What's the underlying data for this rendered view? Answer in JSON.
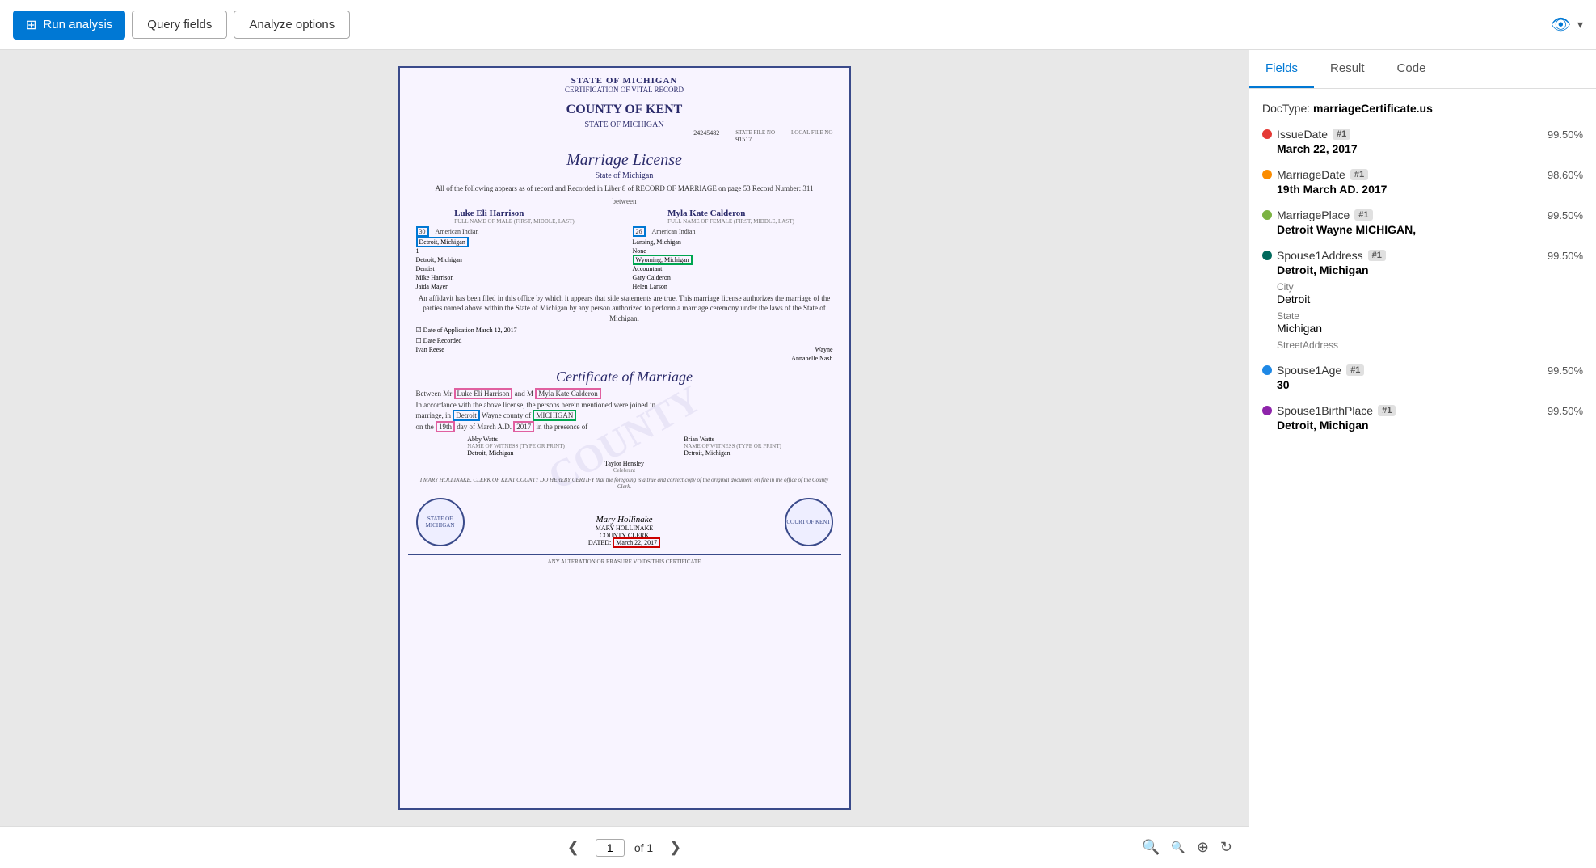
{
  "toolbar": {
    "run_label": "Run analysis",
    "query_fields_label": "Query fields",
    "analyze_options_label": "Analyze options"
  },
  "panel": {
    "tabs": [
      {
        "id": "fields",
        "label": "Fields",
        "active": true
      },
      {
        "id": "result",
        "label": "Result",
        "active": false
      },
      {
        "id": "code",
        "label": "Code",
        "active": false
      }
    ],
    "doctype_label": "DocType:",
    "doctype_value": "marriageCertificate.us",
    "fields": [
      {
        "name": "IssueDate",
        "badge": "#1",
        "confidence": "99.50%",
        "value": "March 22, 2017",
        "dot_color": "#e53935",
        "subitems": []
      },
      {
        "name": "MarriageDate",
        "badge": "#1",
        "confidence": "98.60%",
        "value": "19th March AD. 2017",
        "dot_color": "#fb8c00",
        "subitems": []
      },
      {
        "name": "MarriagePlace",
        "badge": "#1",
        "confidence": "99.50%",
        "value": "Detroit Wayne MICHIGAN,",
        "dot_color": "#7cb342",
        "subitems": []
      },
      {
        "name": "Spouse1Address",
        "badge": "#1",
        "confidence": "99.50%",
        "value": "Detroit, Michigan",
        "dot_color": "#00695c",
        "subitems": [
          {
            "label": "City",
            "value": "Detroit"
          },
          {
            "label": "State",
            "value": "Michigan"
          },
          {
            "label": "StreetAddress",
            "value": ""
          }
        ]
      },
      {
        "name": "Spouse1Age",
        "badge": "#1",
        "confidence": "99.50%",
        "value": "30",
        "dot_color": "#1e88e5",
        "subitems": []
      },
      {
        "name": "Spouse1BirthPlace",
        "badge": "#1",
        "confidence": "99.50%",
        "value": "Detroit, Michigan",
        "dot_color": "#8e24aa",
        "subitems": []
      }
    ]
  },
  "pagination": {
    "current_page": "1",
    "of_label": "of 1",
    "prev_label": "❮",
    "next_label": "❯"
  },
  "certificate": {
    "state_title": "STATE OF MICHIGAN",
    "certification": "CERTIFICATION OF VITAL RECORD",
    "county": "COUNTY OF KENT",
    "state_name": "STATE OF MICHIGAN",
    "file_no_1": "24245482",
    "file_no_2_label": "STATE FILE NO",
    "file_no_2": "91517",
    "file_no_3_label": "LOCAL FILE NO",
    "main_title": "Marriage License",
    "subtitle": "State of Michigan",
    "body_text": "All of the following appears as of record and Recorded in Liber 8 of RECORD OF MARRIAGE on page 53 Record Number: 311",
    "between": "between",
    "male_name": "Luke Eli Harrison",
    "female_name": "Myla Kate Calderon",
    "male_label": "FULL NAME OF MALE (FIRST, MIDDLE, LAST)",
    "female_label": "FULL NAME OF FEMALE (FIRST, MIDDLE, LAST)",
    "male_age": "30",
    "male_race": "American Indian",
    "female_age": "26",
    "female_race": "American Indian",
    "male_city": "Detroit, Michigan",
    "female_city": "Lansing, Michigan",
    "times_married_m": "1",
    "times_married_f": "None",
    "birthplace_m": "Detroit, Michigan",
    "birthplace_f": "Wyoming, Michigan",
    "occupation_m": "Dentist",
    "occupation_f": "Accountant",
    "fathers_name_m": "Mike Harrison",
    "fathers_name_f": "Gary Calderon",
    "mothers_name_m": "Jaida Mayer",
    "mothers_name_f": "Helen Larson",
    "affidavit_text": "An affidavit has been filed in this office by which it appears that side statements are true. This marriage license authorizes the marriage of the parties named above within the State of Michigan by any person authorized to perform a marriage ceremony under the laws of the State of Michigan.",
    "date_application": "March 12, 2017",
    "county_clerk": "Ivan Reese",
    "county_name": "Wayne",
    "deputy_clerk": "Annabelle Nash",
    "marriage_cert_title": "Certificate of Marriage",
    "cert_between_m": "Luke Eli Harrison",
    "cert_between_f": "Myla Kate Calderon",
    "cert_city": "Detroit",
    "cert_county": "Wayne",
    "cert_state": "MICHIGAN",
    "cert_day": "19th",
    "cert_month": "March",
    "cert_year": "2017",
    "cert_year_ad": "A.D.",
    "witness1": "Abby Watts",
    "witness2": "Brian Watts",
    "witness1_addr": "Detroit, Michigan",
    "witness2_addr": "Detroit, Michigan",
    "officiant": "Taylor Hensley",
    "officiant_title": "Celebrant",
    "clerk_text": "I MARY HOLLINAKE, CLERK OF KENT COUNTY DO HEREBY CERTIFY that the foregoing is a true and correct copy of the original document on file in the office of the County Clerk.",
    "clerk_name": "MARY HOLLINAKE",
    "clerk_title": "COUNTY CLERK",
    "dated_text": "DATED:",
    "dated_value": "March 22, 2017",
    "footer_note": "ANY ALTERATION OR ERASURE VOIDS THIS CERTIFICATE"
  }
}
